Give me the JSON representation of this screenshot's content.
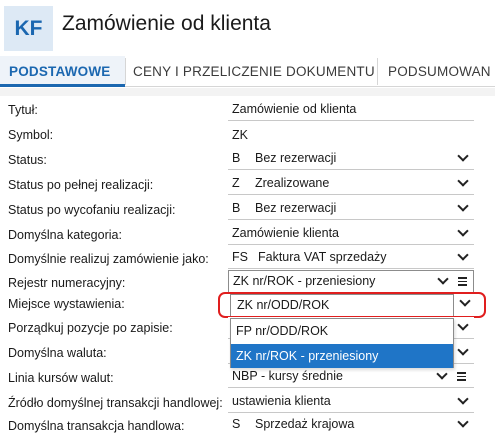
{
  "header": {
    "badge": "KF",
    "title": "Zamówienie od klienta"
  },
  "tabs": [
    {
      "label": "PODSTAWOWE",
      "active": true
    },
    {
      "label": "CENY I PRZELICZENIE DOKUMENTU",
      "active": false
    },
    {
      "label": "PODSUMOWAN",
      "active": false
    }
  ],
  "form": {
    "rows": [
      {
        "label": "Tytuł:",
        "code": "",
        "value": "Zamówienie od klienta",
        "kind": "text"
      },
      {
        "label": "Symbol:",
        "code": "",
        "value": "ZK",
        "kind": "static"
      },
      {
        "label": "Status:",
        "code": "B",
        "value": "Bez rezerwacji",
        "kind": "select"
      },
      {
        "label": "Status po pełnej realizacji:",
        "code": "Z",
        "value": "Zrealizowane",
        "kind": "select"
      },
      {
        "label": "Status po wycofaniu realizacji:",
        "code": "B",
        "value": "Bez rezerwacji",
        "kind": "select"
      },
      {
        "label": "Domyślna kategoria:",
        "code": "",
        "value": "Zamówienie klienta",
        "kind": "select"
      },
      {
        "label": "Domyślnie realizuj zamówienie jako:",
        "code": "FS",
        "value": "Faktura VAT sprzedaży",
        "kind": "select"
      },
      {
        "label": "Rejestr numeracyjny:",
        "code": "",
        "value": "ZK nr/ROK - przeniesiony",
        "kind": "select-menu"
      },
      {
        "label": "Miejsce wystawienia:",
        "code": "",
        "value": "ZK nr/ODD/ROK",
        "kind": "select-open"
      },
      {
        "label": "Porządkuj pozycje po zapisie:",
        "code": "",
        "value": "",
        "kind": "hidden"
      },
      {
        "label": "Domyślna waluta:",
        "code": "",
        "value": "",
        "kind": "hidden"
      },
      {
        "label": "Linia kursów walut:",
        "code": "",
        "value": "NBP - kursy średnie",
        "kind": "select-menu"
      },
      {
        "label": "Źródło domyślnej transakcji handlowej:",
        "code": "",
        "value": "ustawienia klienta",
        "kind": "select"
      },
      {
        "label": "Domyślna transakcja handlowa:",
        "code": "S",
        "value": "Sprzedaż krajowa",
        "kind": "select"
      }
    ]
  },
  "dropdown": {
    "options": [
      {
        "label": "FP nr/ODD/ROK",
        "selected": false
      },
      {
        "label": "ZK nr/ROK - przeniesiony",
        "selected": true
      }
    ]
  },
  "colors": {
    "accent": "#1b67b0",
    "highlight": "#e01e1e",
    "selection": "#1f75c7"
  }
}
